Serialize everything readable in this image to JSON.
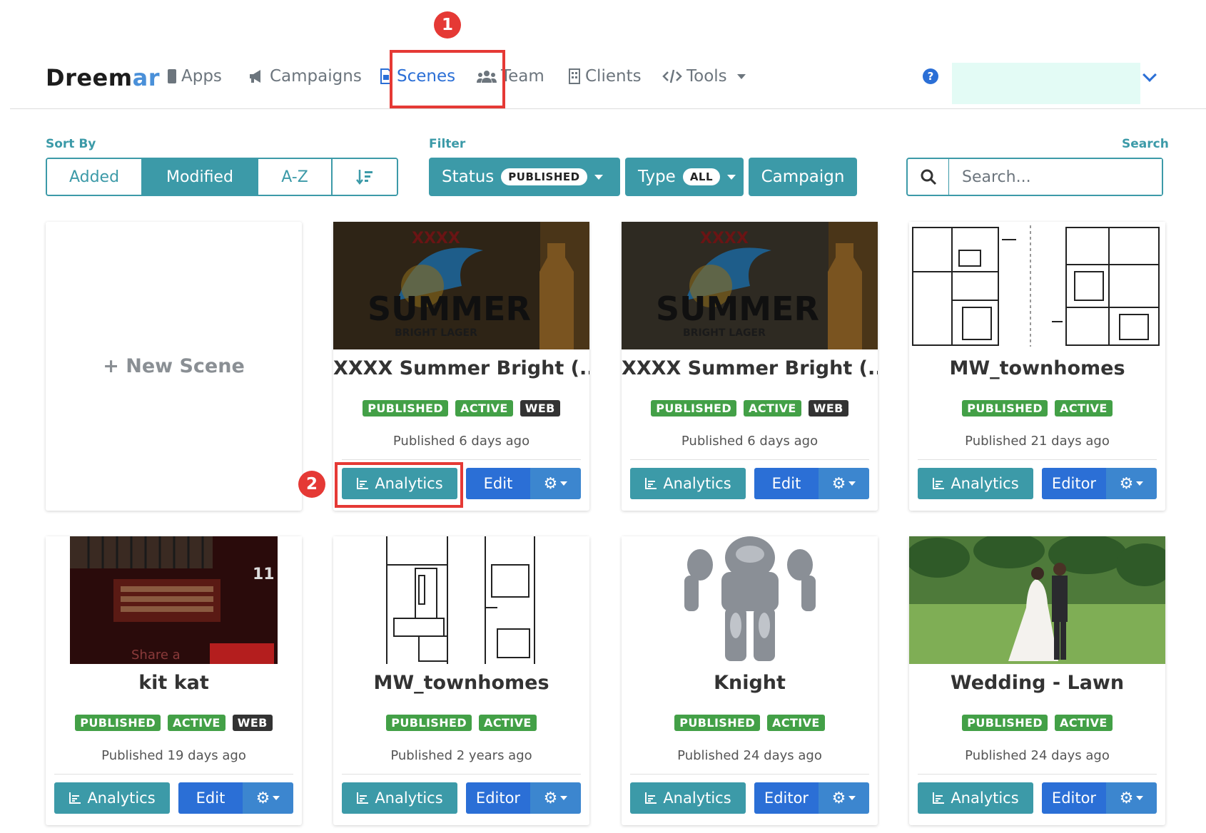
{
  "nav": {
    "brand_main": "Dreem",
    "brand_accent": "ar",
    "items": [
      {
        "label": "Apps",
        "icon": "phone-icon"
      },
      {
        "label": "Campaigns",
        "icon": "megaphone-icon"
      },
      {
        "label": "Scenes",
        "icon": "scene-file-icon",
        "active": true
      },
      {
        "label": "Team",
        "icon": "users-icon"
      },
      {
        "label": "Clients",
        "icon": "building-icon"
      },
      {
        "label": "Tools",
        "icon": "code-icon"
      }
    ],
    "help": "?"
  },
  "annotations": {
    "one": "1",
    "two": "2"
  },
  "toolbar": {
    "sort_label": "Sort By",
    "sort_options": [
      "Added",
      "Modified",
      "A-Z"
    ],
    "sort_active": "Modified",
    "filter_label": "Filter",
    "status_label": "Status",
    "status_value": "PUBLISHED",
    "type_label": "Type",
    "type_value": "ALL",
    "campaign_label": "Campaign",
    "search_label": "Search",
    "search_placeholder": "Search..."
  },
  "new_scene": "+ New Scene",
  "cards": [
    {
      "title": "XXXX Summer Bright (...",
      "badges": [
        "PUBLISHED",
        "ACTIVE",
        "WEB"
      ],
      "published": "Published 6 days ago",
      "analytics": "Analytics",
      "edit": "Edit"
    },
    {
      "title": "XXXX Summer Bright (...",
      "badges": [
        "PUBLISHED",
        "ACTIVE",
        "WEB"
      ],
      "published": "Published 6 days ago",
      "analytics": "Analytics",
      "edit": "Edit"
    },
    {
      "title": "MW_townhomes",
      "badges": [
        "PUBLISHED",
        "ACTIVE"
      ],
      "published": "Published 21 days ago",
      "analytics": "Analytics",
      "edit": "Editor"
    },
    {
      "title": "kit kat",
      "badges": [
        "PUBLISHED",
        "ACTIVE",
        "WEB"
      ],
      "published": "Published 19 days ago",
      "analytics": "Analytics",
      "edit": "Edit"
    },
    {
      "title": "MW_townhomes",
      "badges": [
        "PUBLISHED",
        "ACTIVE"
      ],
      "published": "Published 2 years ago",
      "analytics": "Analytics",
      "edit": "Editor"
    },
    {
      "title": "Knight",
      "badges": [
        "PUBLISHED",
        "ACTIVE"
      ],
      "published": "Published 24 days ago",
      "analytics": "Analytics",
      "edit": "Editor"
    },
    {
      "title": "Wedding - Lawn",
      "badges": [
        "PUBLISHED",
        "ACTIVE"
      ],
      "published": "Published 24 days ago",
      "analytics": "Analytics",
      "edit": "Editor"
    }
  ],
  "colors": {
    "teal": "#3c9aa8",
    "blue": "#2b6fd6",
    "badge_green": "#43a047",
    "badge_dark": "#333333",
    "annotation_red": "#e53935"
  },
  "thumbnail_text": {
    "summer": "SUMMER",
    "lager": "BRIGHT LAGER",
    "xxxx": "XXXX",
    "kitkat_share": "Share a",
    "kitkat_num": "11"
  }
}
